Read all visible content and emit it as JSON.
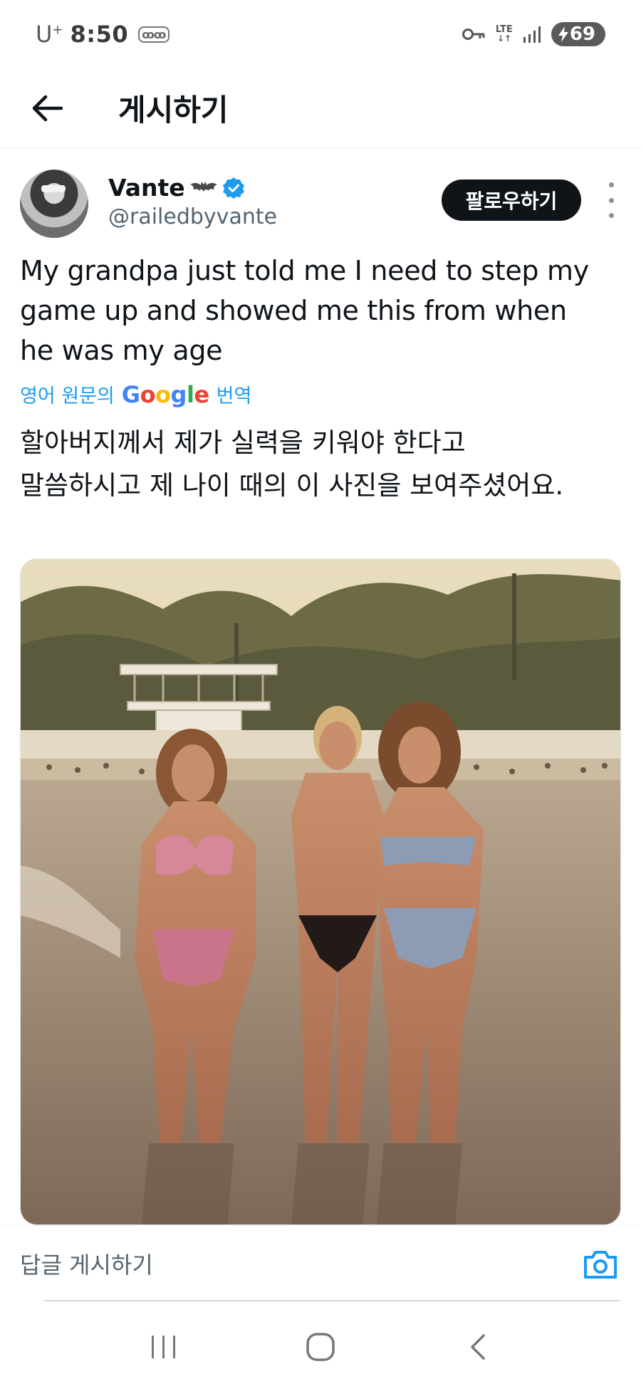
{
  "status_bar": {
    "carrier": "U",
    "carrier_sup": "+",
    "time": "8:50",
    "mini_icon": "ꝏꝏ",
    "network": "LTE",
    "battery": "69",
    "icons": [
      "key-icon",
      "lte-icon",
      "signal-icon",
      "battery-charging-icon"
    ]
  },
  "header": {
    "title": "게시하기",
    "back_icon": "back-arrow-icon"
  },
  "tweet": {
    "author": {
      "display_name": "Vante",
      "verified": true,
      "handle": "@railedbyvante"
    },
    "follow_label": "팔로우하기",
    "text_lines": [
      "My grandpa just told me I need to step my",
      "game up and showed me this from when",
      "he was my age"
    ],
    "translate": {
      "prefix": "영어 원문의",
      "google": [
        "G",
        "o",
        "o",
        "g",
        "l",
        "e"
      ],
      "suffix": "번역"
    },
    "translated_lines": [
      "할아버지께서 제가 실력을 키워야 한다고",
      "말씀하시고 제 나이 때의 이 사진을 보여주셨어요."
    ]
  },
  "reply": {
    "placeholder": "답글 게시하기",
    "camera_icon": "camera-icon"
  },
  "nav": {
    "buttons": [
      "recent-apps-icon",
      "home-icon",
      "back-icon"
    ]
  },
  "colors": {
    "accent": "#1d9bf0",
    "text": "#0f1419",
    "secondary": "#536471"
  }
}
